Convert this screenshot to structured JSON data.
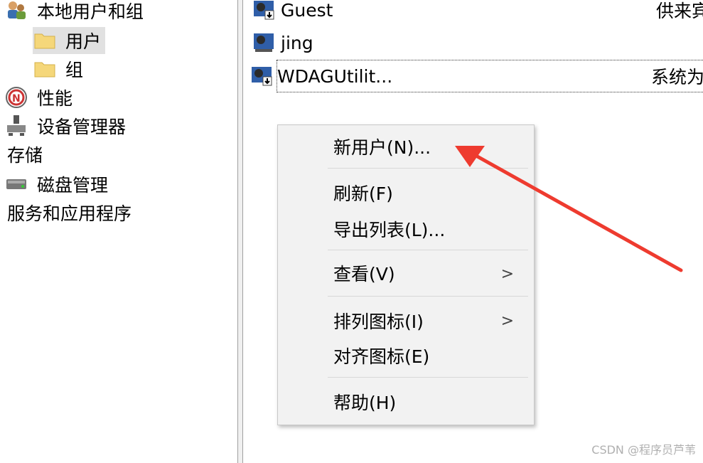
{
  "tree": {
    "local_users_groups": "本地用户和组",
    "users": "用户",
    "groups": "组",
    "performance": "性能",
    "device_manager": "设备管理器",
    "storage": "存储",
    "disk_management": "磁盘管理",
    "services_apps": "服务和应用程序"
  },
  "users_list": [
    {
      "name": "Guest",
      "desc": "供来宾"
    },
    {
      "name": "jing",
      "desc": ""
    },
    {
      "name": "WDAGUtilit...",
      "desc": "系统为"
    }
  ],
  "context_menu": {
    "new_user": "新用户(N)...",
    "refresh": "刷新(F)",
    "export_list": "导出列表(L)...",
    "view": "查看(V)",
    "arrange_icons": "排列图标(I)",
    "align_icons": "对齐图标(E)",
    "help": "帮助(H)",
    "submenu_glyph": ">"
  },
  "watermark": "CSDN @程序员芦苇",
  "colors": {
    "annotation_arrow": "#ee3b2f",
    "menu_bg": "#f2f2f2",
    "selection": "#e1e1e1"
  }
}
